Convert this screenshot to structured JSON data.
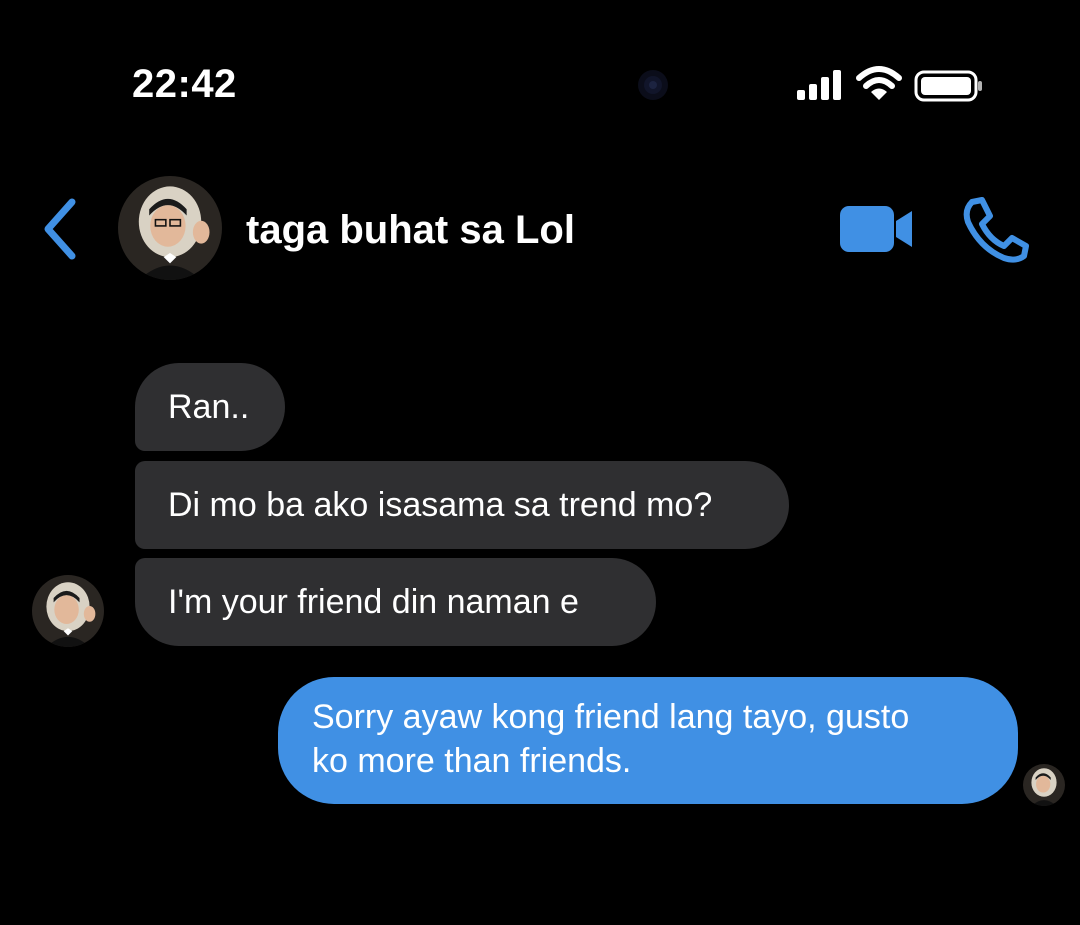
{
  "status_bar": {
    "time": "22:42"
  },
  "header": {
    "contact_name": "taga buhat sa Lol"
  },
  "messages": {
    "incoming": [
      "Ran..",
      "Di mo ba ako isasama sa trend mo?",
      "I'm your friend din naman e"
    ],
    "outgoing": [
      {
        "line1": "Sorry ayaw kong friend lang tayo, gusto",
        "line2": "ko more than friends."
      }
    ]
  },
  "colors": {
    "background": "#000000",
    "accent": "#4090e4",
    "incoming_bubble": "#2f2f31",
    "text": "#ffffff"
  },
  "icons": {
    "back": "chevron-left-icon",
    "video": "video-camera-icon",
    "call": "phone-icon",
    "signal": "cellular-signal-icon",
    "wifi": "wifi-icon",
    "battery": "battery-icon"
  }
}
